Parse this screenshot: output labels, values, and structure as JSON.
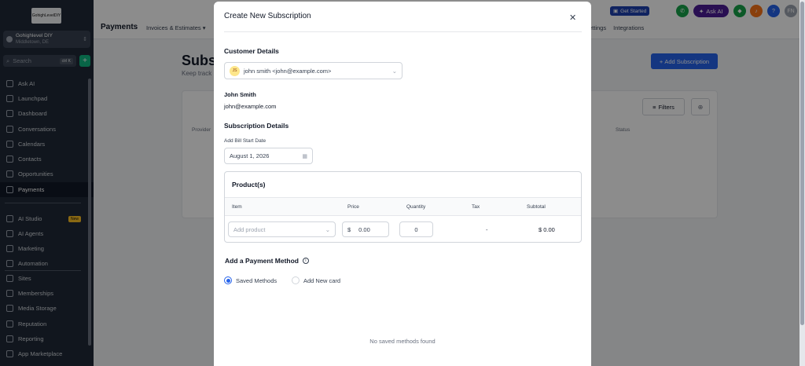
{
  "sidebar": {
    "logo_text": "GohighLevelDIY",
    "account_name": "Gohighlevel DIY",
    "account_location": "Middletown, DE",
    "search_placeholder": "Search",
    "search_shortcut": "ctrl K",
    "items": [
      {
        "label": "Ask AI"
      },
      {
        "label": "Launchpad"
      },
      {
        "label": "Dashboard"
      },
      {
        "label": "Conversations"
      },
      {
        "label": "Calendars"
      },
      {
        "label": "Contacts"
      },
      {
        "label": "Opportunities"
      },
      {
        "label": "Payments"
      },
      {
        "label": "AI Studio",
        "badge": "New"
      },
      {
        "label": "AI Agents"
      },
      {
        "label": "Marketing"
      },
      {
        "label": "Automation"
      },
      {
        "label": "Sites"
      },
      {
        "label": "Memberships"
      },
      {
        "label": "Media Storage"
      },
      {
        "label": "Reputation"
      },
      {
        "label": "Reporting"
      },
      {
        "label": "App Marketplace"
      }
    ]
  },
  "topbar": {
    "section": "Payments",
    "tab_invoices": "Invoices & Estimates",
    "tab_settings": "ettings",
    "tab_integrations": "Integrations",
    "get_started": "Get Started",
    "ask_ai": "Ask AI",
    "avatar_initials": "FN"
  },
  "background": {
    "title": "Subsc",
    "subtitle": "Keep track",
    "add_subscription": "Add Subscription",
    "filters": "Filters",
    "col_provider": "Provider",
    "col_status": "Status"
  },
  "modal": {
    "title": "Create New Subscription",
    "customer_details_heading": "Customer Details",
    "customer_select_value": "john smith <john@example.com>",
    "customer_initials": "JS",
    "customer_name": "John Smith",
    "customer_email": "john@example.com",
    "subscription_details_heading": "Subscription Details",
    "bill_start_label": "Add Bill Start Date",
    "bill_start_value": "August 1, 2026",
    "products": {
      "heading": "Product(s)",
      "col_item": "Item",
      "col_price": "Price",
      "col_quantity": "Quantity",
      "col_tax": "Tax",
      "col_subtotal": "Subtotal",
      "add_product_placeholder": "Add product",
      "currency": "$",
      "price_value": "0.00",
      "quantity_value": "0",
      "tax_value": "-",
      "subtotal_value": "$ 0.00"
    },
    "payment_method_heading": "Add a Payment Method",
    "saved_methods": "Saved Methods",
    "add_new_card": "Add New card",
    "empty_message": "No saved methods found"
  },
  "colors": {
    "sidebar_bg": "#1f2937",
    "primary": "#2563eb",
    "ask_ai": "#4c1d95"
  }
}
